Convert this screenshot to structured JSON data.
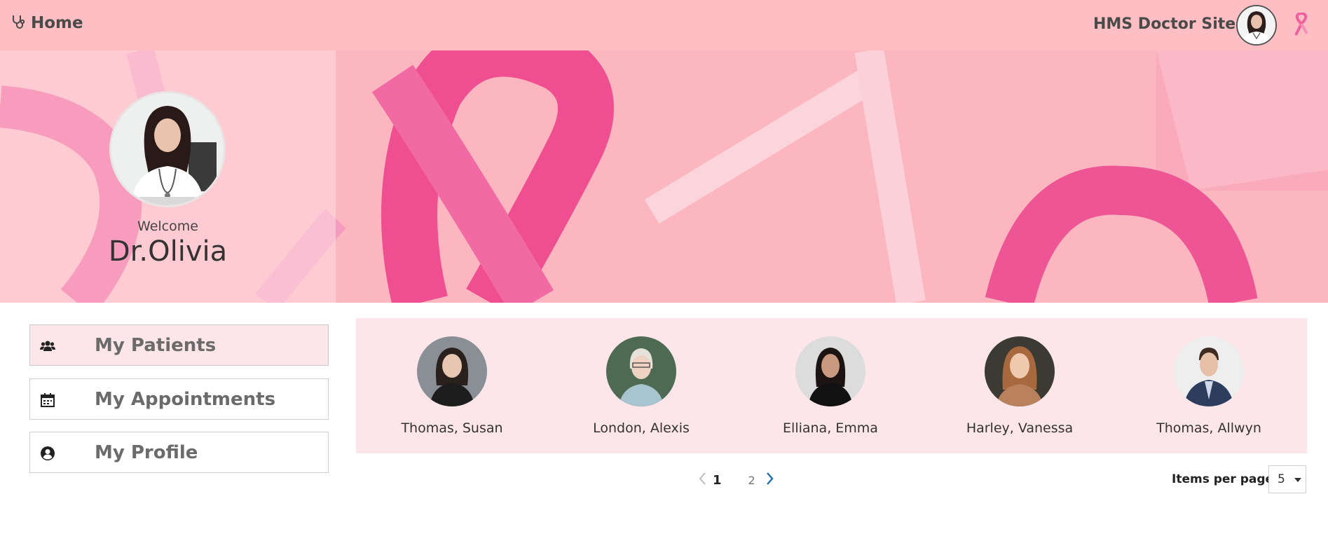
{
  "header": {
    "home_label": "Home",
    "site_label": "HMS Doctor Site",
    "home_icon": "stethoscope-icon",
    "brand_icon": "pink-ribbon-icon"
  },
  "banner": {
    "welcome": "Welcome",
    "doctor_name": "Dr.Olivia"
  },
  "sidebar": {
    "items": [
      {
        "label": "My Patients",
        "icon": "users-icon",
        "active": true
      },
      {
        "label": "My Appointments",
        "icon": "calendar-icon",
        "active": false
      },
      {
        "label": "My Profile",
        "icon": "user-circle-icon",
        "active": false
      }
    ]
  },
  "patients": [
    {
      "name": "Thomas, Susan"
    },
    {
      "name": "London, Alexis"
    },
    {
      "name": "Elliana, Emma"
    },
    {
      "name": "Harley, Vanessa"
    },
    {
      "name": "Thomas, Allwyn"
    }
  ],
  "pagination": {
    "current_page": "1",
    "next_page": "2",
    "items_per_page_label": "Items per page",
    "items_per_page_value": "5"
  },
  "colors": {
    "header_bg": "#fdbfc3",
    "panel_bg": "#fde6ea",
    "ribbon_pink": "#f0609e",
    "link_blue": "#1f6fb2"
  }
}
